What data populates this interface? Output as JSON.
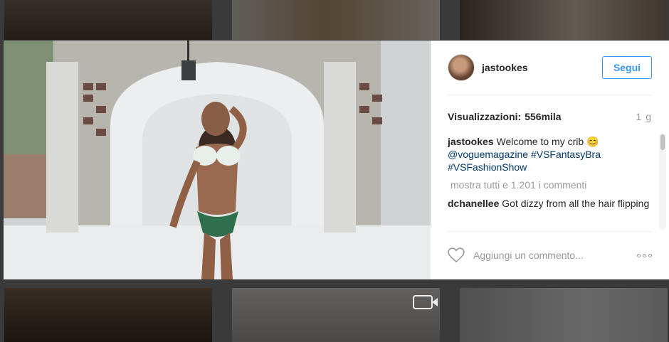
{
  "post": {
    "username": "jastookes",
    "follow_label": "Segui",
    "views_label": "Visualizzazioni:",
    "views_count": "556mila",
    "time_ago": "1 g"
  },
  "caption": {
    "username": "jastookes",
    "text": "Welcome to my crib",
    "emoji": "😊",
    "mention": "@voguemagazine",
    "tag1": "#VSFantasyBra",
    "tag2": "#VSFashionShow"
  },
  "comments": {
    "show_all": "mostra tutti e 1.201 i commenti",
    "items": [
      {
        "username": "dchanellee",
        "text": "Got dizzy from all the hair flipping"
      }
    ]
  },
  "footer": {
    "add_comment_placeholder": "Aggiungi un commento..."
  },
  "icons": {
    "heart": "heart-icon",
    "options": "more-options-icon",
    "video": "video-camera-icon"
  },
  "colors": {
    "accent": "#3897f0",
    "link": "#003569",
    "muted": "#999999"
  }
}
